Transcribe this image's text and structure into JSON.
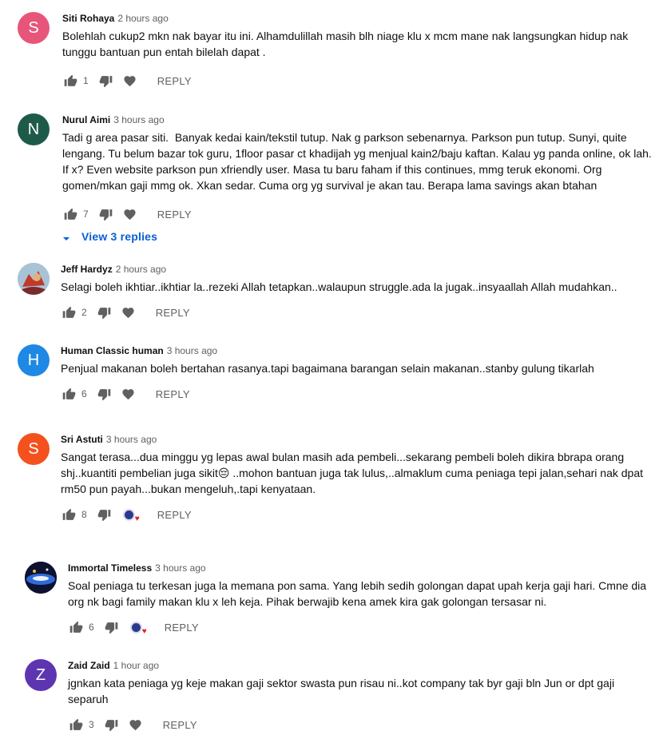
{
  "comments": [
    {
      "author": "Siti Rohaya",
      "time": "2 hours ago",
      "avatar_letter": "S",
      "avatar_color": "#e8557a",
      "text": "Bolehlah cukup2 mkn nak bayar itu ini. Alhamdulillah masih blh niage klu x mcm mane nak langsungkan hidup nak tunggu bantuan pun entah bilelah dapat .",
      "likes": "1",
      "reply_label": "REPLY"
    },
    {
      "author": "Nurul Aimi",
      "time": "3 hours ago",
      "avatar_letter": "N",
      "avatar_color": "#1e5a4a",
      "text": "Tadi g area pasar siti.  Banyak kedai kain/tekstil tutup. Nak g parkson sebenarnya. Parkson pun tutup. Sunyi, quite lengang. Tu belum bazar tok guru, 1floor pasar ct khadijah yg menjual kain2/baju kaftan. Kalau yg panda online, ok lah. If x? Even website parkson pun xfriendly user. Masa tu baru faham if this continues, mmg teruk ekonomi. Org gomen/mkan gaji mmg ok. Xkan sedar. Cuma org yg survival je akan tau. Berapa lama savings akan btahan",
      "likes": "7",
      "reply_label": "REPLY",
      "view_replies": "View 3 replies"
    },
    {
      "author": "Jeff Hardyz",
      "time": "2 hours ago",
      "text": "Selagi boleh ikhtiar..ikhtiar la..rezeki Allah tetapkan..walaupun struggle.ada la jugak..insyaallah Allah mudahkan..",
      "likes": "2",
      "reply_label": "REPLY"
    },
    {
      "author": "Human Classic human",
      "time": "3 hours ago",
      "avatar_letter": "H",
      "avatar_color": "#1e88e5",
      "text": "Penjual makanan boleh bertahan rasanya.tapi bagaimana barangan selain makanan..stanby gulung tikarlah",
      "likes": "6",
      "reply_label": "REPLY"
    },
    {
      "author": "Sri Astuti",
      "time": "3 hours ago",
      "avatar_letter": "S",
      "avatar_color": "#f4511e",
      "text": "Sangat terasa...dua minggu yg lepas awal bulan masih ada pembeli...sekarang pembeli boleh dikira bbrapa orang shj..kuantiti pembelian juga sikit😔 ..mohon bantuan juga tak lulus,..almaklum cuma peniaga tepi jalan,sehari nak dpat rm50 pun payah...bukan mengeluh,.tapi kenyataan.",
      "likes": "8",
      "reply_label": "REPLY",
      "creator_hearted": true
    },
    {
      "author": "Immortal Timeless",
      "time": "3 hours ago",
      "text": "Soal peniaga tu terkesan juga la memana pon sama. Yang lebih sedih golongan dapat upah kerja gaji hari. Cmne dia org nk bagi family makan klu x leh keja. Pihak berwajib kena amek kira gak golongan tersasar ni.",
      "likes": "6",
      "reply_label": "REPLY",
      "creator_hearted": true
    },
    {
      "author": "Zaid Zaid",
      "time": "1 hour ago",
      "avatar_letter": "Z",
      "avatar_color": "#5e35b1",
      "text": "jgnkan kata peniaga yg keje makan gaji sektor swasta pun risau ni..kot company tak byr gaji bln Jun or dpt gaji separuh",
      "likes": "3",
      "reply_label": "REPLY"
    }
  ]
}
